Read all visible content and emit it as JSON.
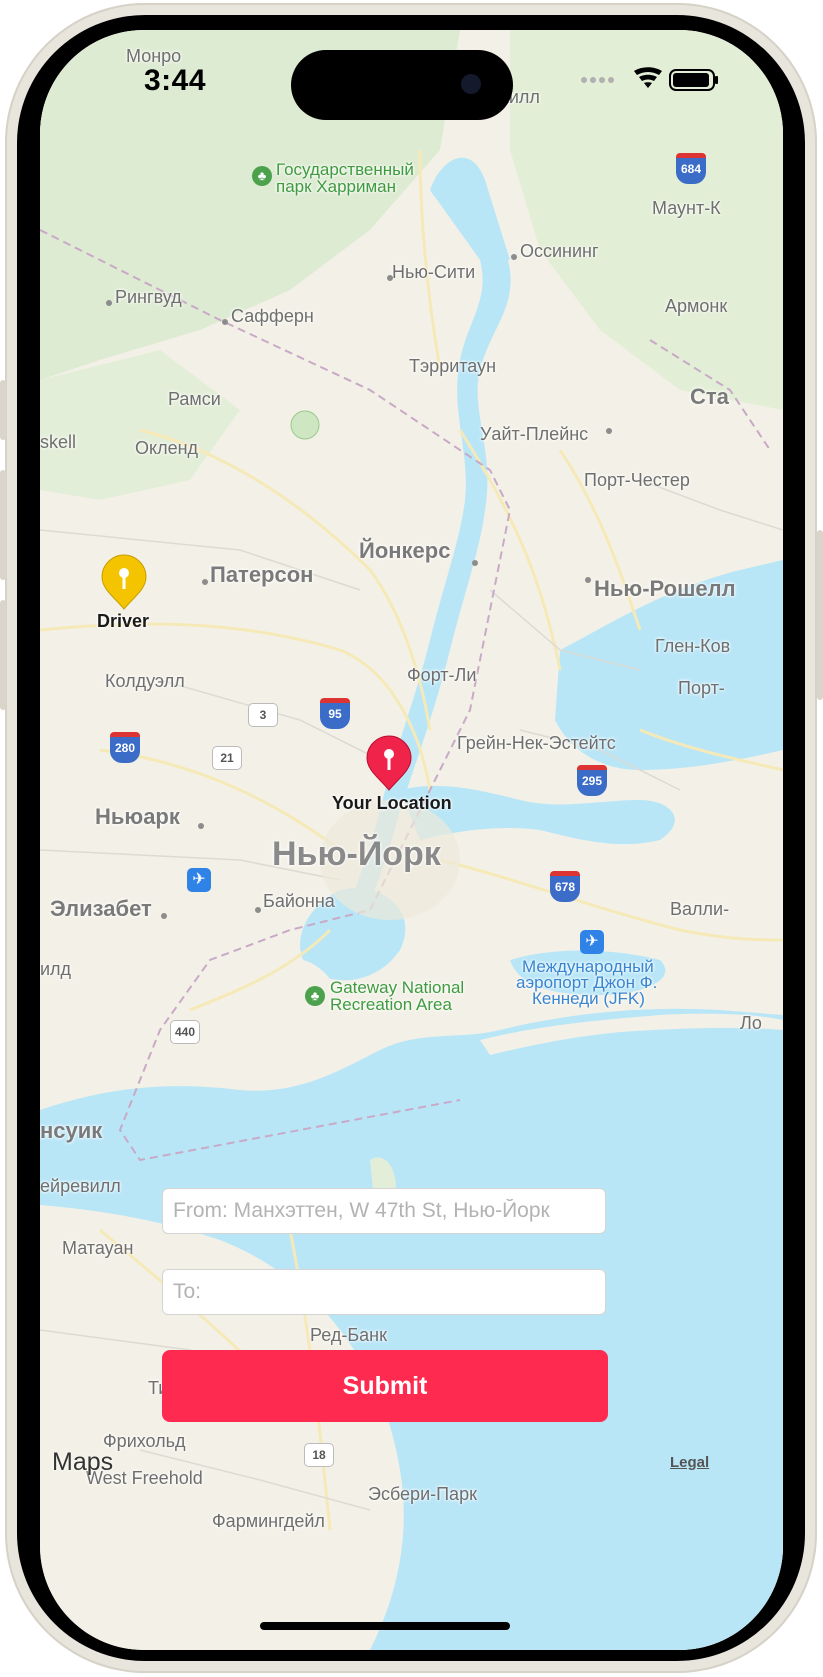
{
  "status_bar": {
    "time": "3:44"
  },
  "map": {
    "labels": {
      "monro": "Монро",
      "peekskill": "скилл",
      "harriman_park_line1": "Государственный",
      "harriman_park_line2": "парк Харриман",
      "mount_kisco": "Маунт-К",
      "ossining": "Оссининг",
      "new_city": "Нью-Сити",
      "ringwood": "Рингвуд",
      "suffern": "Сафферн",
      "armonk": "Армонк",
      "tarrytown": "Тэрритаун",
      "stamford": "Ста",
      "ramsey": "Рамси",
      "white_plains": "Уайт-Плейнс",
      "oakland": "Окленд",
      "peekskill_west": "skell",
      "port_chester": "Порт-Честер",
      "yonkers": "Йонкерс",
      "paterson": "Патерсон",
      "new_rochelle": "Нью-Рошелл",
      "glen_cove": "Глен-Ков",
      "fort_lee": "Форт-Ли",
      "caldwell": "Колдуэлл",
      "port_washington": "Порт-",
      "great_neck": "Грейн-Нек-Эстейтс",
      "newark": "Ньюарк",
      "new_york": "Нью-Йорк",
      "elizabeth": "Элизабет",
      "bayonne": "Байонна",
      "valley_stream": "Валли-",
      "plainfield": "илд",
      "jfk_line1": "Международный",
      "jfk_line2": "аэропорт Джон Ф.",
      "jfk_line3": "Кеннеди (JFK)",
      "gateway_line1": "Gateway National",
      "gateway_line2": "Recreation Area",
      "long_beach": "Ло",
      "brunswick": "нсуик",
      "sayreville": "ейревилл",
      "matawan": "Матауан",
      "red_bank": "Ред-Банк",
      "tinton": "Ти",
      "freehold": "Фрихольд",
      "west_freehold": "West Freehold",
      "asbury_park": "Эсбери-Парк",
      "farmingdale": "Фармингдейл"
    },
    "shields": {
      "i684": "684",
      "i95": "95",
      "i280": "280",
      "i295": "295",
      "i678": "678",
      "r3": "3",
      "r21": "21",
      "r440": "440",
      "r18": "18"
    },
    "pins": {
      "driver": {
        "label": "Driver",
        "color": "#f5c400"
      },
      "your_location": {
        "label": "Your Location",
        "color": "#f0244a"
      }
    },
    "attribution": {
      "logo": "Maps",
      "legal": "Legal"
    }
  },
  "form": {
    "from_placeholder": "From: Манхэттен, W 47th St, Нью-Йорк",
    "to_placeholder": "To:",
    "submit_label": "Submit"
  },
  "colors": {
    "accent": "#ff2a4f",
    "water": "#b9e6f7",
    "land": "#f3f1e7"
  }
}
